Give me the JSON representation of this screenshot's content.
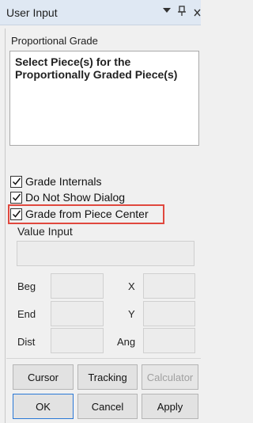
{
  "window": {
    "title": "User Input",
    "icons": [
      "dropdown-arrow-icon",
      "pin-icon",
      "close-icon"
    ]
  },
  "panel": {
    "heading": "Proportional Grade",
    "prompt": "Select Piece(s) for the Proportionally Graded Piece(s)"
  },
  "options": [
    {
      "label": "Grade Internals",
      "checked": true
    },
    {
      "label": "Do Not Show Dialog",
      "checked": true
    },
    {
      "label": "Grade from Piece Center",
      "checked": true,
      "highlighted": true
    }
  ],
  "value_input": {
    "label": "Value Input",
    "value": "",
    "rows": [
      {
        "left_label": "Beg",
        "right_label": "X"
      },
      {
        "left_label": "End",
        "right_label": "Y"
      },
      {
        "left_label": "Dist",
        "right_label": "Ang"
      }
    ]
  },
  "tool_buttons": [
    {
      "label": "Cursor",
      "enabled": true
    },
    {
      "label": "Tracking",
      "enabled": true
    },
    {
      "label": "Calculator",
      "enabled": false
    }
  ],
  "action_buttons": {
    "ok": "OK",
    "cancel": "Cancel",
    "apply": "Apply"
  },
  "colors": {
    "titlebar": "#dfe8f3",
    "highlight_border": "#e0483e",
    "default_button_border": "#2a78d6"
  }
}
